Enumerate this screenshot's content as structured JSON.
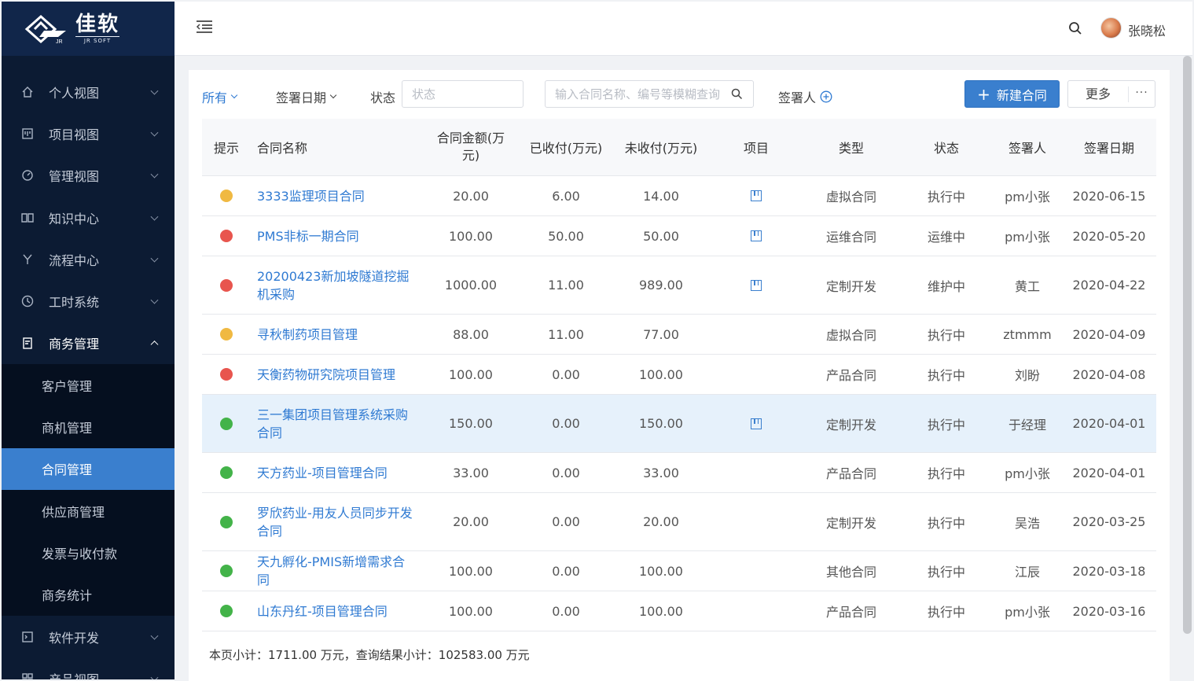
{
  "logo": {
    "cn": "佳软",
    "en": "JR SOFT",
    "mark": "JR"
  },
  "sidebar": {
    "items": [
      {
        "label": "个人视图",
        "icon": "home-icon"
      },
      {
        "label": "项目视图",
        "icon": "board-icon"
      },
      {
        "label": "管理视图",
        "icon": "dashboard-icon"
      },
      {
        "label": "知识中心",
        "icon": "book-icon"
      },
      {
        "label": "流程中心",
        "icon": "flow-icon"
      },
      {
        "label": "工时系统",
        "icon": "clock-icon"
      },
      {
        "label": "商务管理",
        "icon": "clipboard-icon",
        "open": true
      }
    ],
    "submenu": [
      {
        "label": "客户管理"
      },
      {
        "label": "商机管理"
      },
      {
        "label": "合同管理",
        "active": true
      },
      {
        "label": "供应商管理"
      },
      {
        "label": "发票与收付款"
      },
      {
        "label": "商务统计"
      }
    ],
    "after": [
      {
        "label": "软件开发",
        "icon": "code-icon"
      },
      {
        "label": "产品视图",
        "icon": "grid-icon"
      }
    ]
  },
  "header": {
    "username": "张晓松"
  },
  "filters": {
    "all": "所有",
    "date": "签署日期",
    "status_label": "状态",
    "status_placeholder": "状态",
    "search_placeholder": "输入合同名称、编号等模糊查询",
    "signer": "签署人",
    "new_button": "新建合同",
    "new_plus": "+",
    "more": "更多",
    "more_dots": "···"
  },
  "table": {
    "columns": {
      "tip": "提示",
      "name": "合同名称",
      "amount": "合同金额(万元)",
      "paid": "已收付(万元)",
      "unpaid": "未收付(万元)",
      "project": "项目",
      "type": "类型",
      "status": "状态",
      "signer": "签署人",
      "date": "签署日期"
    },
    "rows": [
      {
        "tip": "#f0b942",
        "name": "3333监理项目合同",
        "amount": "20.00",
        "paid": "6.00",
        "unpaid": "14.00",
        "project": true,
        "type": "虚拟合同",
        "status": "执行中",
        "signer": "pm小张",
        "date": "2020-06-15"
      },
      {
        "tip": "#e8554e",
        "name": "PMS非标一期合同",
        "amount": "100.00",
        "paid": "50.00",
        "unpaid": "50.00",
        "project": true,
        "type": "运维合同",
        "status": "运维中",
        "signer": "pm小张",
        "date": "2020-05-20"
      },
      {
        "tip": "#e8554e",
        "name": "20200423新加坡隧道挖掘机采购",
        "amount": "1000.00",
        "paid": "11.00",
        "unpaid": "989.00",
        "project": true,
        "type": "定制开发",
        "status": "维护中",
        "signer": "黄工",
        "date": "2020-04-22"
      },
      {
        "tip": "#f0b942",
        "name": "寻秋制药项目管理",
        "amount": "88.00",
        "paid": "11.00",
        "unpaid": "77.00",
        "project": false,
        "type": "虚拟合同",
        "status": "执行中",
        "signer": "ztmmm",
        "date": "2020-04-09"
      },
      {
        "tip": "#e8554e",
        "name": "天衡药物研究院项目管理",
        "amount": "100.00",
        "paid": "0.00",
        "unpaid": "100.00",
        "project": false,
        "type": "产品合同",
        "status": "执行中",
        "signer": "刘盼",
        "date": "2020-04-08"
      },
      {
        "tip": "#43b349",
        "name": "三一集团项目管理系统采购合同",
        "amount": "150.00",
        "paid": "0.00",
        "unpaid": "150.00",
        "project": true,
        "type": "定制开发",
        "status": "执行中",
        "signer": "于经理",
        "date": "2020-04-01",
        "highlight": true
      },
      {
        "tip": "#43b349",
        "name": "天方药业-项目管理合同",
        "amount": "33.00",
        "paid": "0.00",
        "unpaid": "33.00",
        "project": false,
        "type": "产品合同",
        "status": "执行中",
        "signer": "pm小张",
        "date": "2020-04-01"
      },
      {
        "tip": "#43b349",
        "name": "罗欣药业-用友人员同步开发合同",
        "amount": "20.00",
        "paid": "0.00",
        "unpaid": "20.00",
        "project": false,
        "type": "定制开发",
        "status": "执行中",
        "signer": "吴浩",
        "date": "2020-03-25"
      },
      {
        "tip": "#43b349",
        "name": "天九孵化-PMIS新增需求合同",
        "amount": "100.00",
        "paid": "0.00",
        "unpaid": "100.00",
        "project": false,
        "type": "其他合同",
        "status": "执行中",
        "signer": "江辰",
        "date": "2020-03-18"
      },
      {
        "tip": "#43b349",
        "name": "山东丹红-项目管理合同",
        "amount": "100.00",
        "paid": "0.00",
        "unpaid": "100.00",
        "project": false,
        "type": "产品合同",
        "status": "执行中",
        "signer": "pm小张",
        "date": "2020-03-16"
      }
    ]
  },
  "summary": "本页小计：1711.00 万元，查询结果小计：102583.00 万元"
}
